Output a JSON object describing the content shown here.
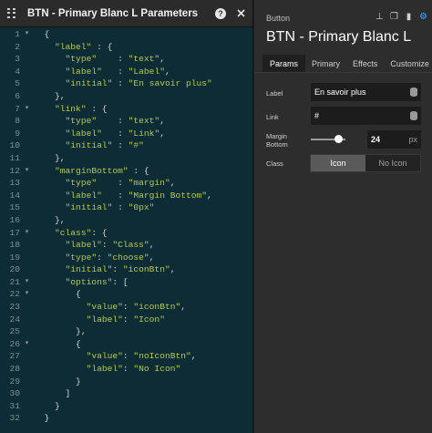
{
  "editor": {
    "title": "BTN - Primary Blanc L Parameters",
    "lines": [
      {
        "n": "1",
        "fold": "▾",
        "parts": [
          [
            "t",
            "  {"
          ]
        ]
      },
      {
        "n": "2",
        "fold": "",
        "parts": [
          [
            "t",
            "    "
          ],
          [
            "s",
            "\"label\""
          ],
          [
            "t",
            " : {"
          ]
        ]
      },
      {
        "n": "3",
        "fold": "",
        "parts": [
          [
            "t",
            "      "
          ],
          [
            "s",
            "\"type\""
          ],
          [
            "t",
            "    : "
          ],
          [
            "s",
            "\"text\""
          ],
          [
            "t",
            ","
          ]
        ]
      },
      {
        "n": "4",
        "fold": "",
        "parts": [
          [
            "t",
            "      "
          ],
          [
            "s",
            "\"label\""
          ],
          [
            "t",
            "   : "
          ],
          [
            "s",
            "\"Label\""
          ],
          [
            "t",
            ","
          ]
        ]
      },
      {
        "n": "5",
        "fold": "",
        "parts": [
          [
            "t",
            "      "
          ],
          [
            "s",
            "\"initial\""
          ],
          [
            "t",
            " : "
          ],
          [
            "s",
            "\"En savoir plus\""
          ]
        ]
      },
      {
        "n": "6",
        "fold": "",
        "parts": [
          [
            "t",
            "    },"
          ]
        ]
      },
      {
        "n": "7",
        "fold": "▾",
        "parts": [
          [
            "t",
            "    "
          ],
          [
            "s",
            "\"link\""
          ],
          [
            "t",
            " : {"
          ]
        ]
      },
      {
        "n": "8",
        "fold": "",
        "parts": [
          [
            "t",
            "      "
          ],
          [
            "s",
            "\"type\""
          ],
          [
            "t",
            "    : "
          ],
          [
            "s",
            "\"text\""
          ],
          [
            "t",
            ","
          ]
        ]
      },
      {
        "n": "9",
        "fold": "",
        "parts": [
          [
            "t",
            "      "
          ],
          [
            "s",
            "\"label\""
          ],
          [
            "t",
            "   : "
          ],
          [
            "s",
            "\"Link\""
          ],
          [
            "t",
            ","
          ]
        ]
      },
      {
        "n": "10",
        "fold": "",
        "parts": [
          [
            "t",
            "      "
          ],
          [
            "s",
            "\"initial\""
          ],
          [
            "t",
            " : "
          ],
          [
            "s",
            "\"#\""
          ]
        ]
      },
      {
        "n": "11",
        "fold": "",
        "parts": [
          [
            "t",
            "    },"
          ]
        ]
      },
      {
        "n": "12",
        "fold": "▾",
        "parts": [
          [
            "t",
            "    "
          ],
          [
            "s",
            "\"marginBottom\""
          ],
          [
            "t",
            " : {"
          ]
        ]
      },
      {
        "n": "13",
        "fold": "",
        "parts": [
          [
            "t",
            "      "
          ],
          [
            "s",
            "\"type\""
          ],
          [
            "t",
            "    : "
          ],
          [
            "s",
            "\"margin\""
          ],
          [
            "t",
            ","
          ]
        ]
      },
      {
        "n": "14",
        "fold": "",
        "parts": [
          [
            "t",
            "      "
          ],
          [
            "s",
            "\"label\""
          ],
          [
            "t",
            "   : "
          ],
          [
            "s",
            "\"Margin Bottom\""
          ],
          [
            "t",
            ","
          ]
        ]
      },
      {
        "n": "15",
        "fold": "",
        "parts": [
          [
            "t",
            "      "
          ],
          [
            "s",
            "\"initial\""
          ],
          [
            "t",
            " : "
          ],
          [
            "s",
            "\"0px\""
          ]
        ]
      },
      {
        "n": "16",
        "fold": "",
        "parts": [
          [
            "t",
            "    },"
          ]
        ]
      },
      {
        "n": "17",
        "fold": "▾",
        "parts": [
          [
            "t",
            "    "
          ],
          [
            "s",
            "\"class\""
          ],
          [
            "t",
            ": {"
          ]
        ]
      },
      {
        "n": "18",
        "fold": "",
        "parts": [
          [
            "t",
            "      "
          ],
          [
            "s",
            "\"label\""
          ],
          [
            "t",
            ": "
          ],
          [
            "s",
            "\"Class\""
          ],
          [
            "t",
            ","
          ]
        ]
      },
      {
        "n": "19",
        "fold": "",
        "parts": [
          [
            "t",
            "      "
          ],
          [
            "s",
            "\"type\""
          ],
          [
            "t",
            ": "
          ],
          [
            "s",
            "\"choose\""
          ],
          [
            "t",
            ","
          ]
        ]
      },
      {
        "n": "20",
        "fold": "",
        "parts": [
          [
            "t",
            "      "
          ],
          [
            "s",
            "\"initial\""
          ],
          [
            "t",
            ": "
          ],
          [
            "s",
            "\"iconBtn\""
          ],
          [
            "t",
            ","
          ]
        ]
      },
      {
        "n": "21",
        "fold": "▾",
        "parts": [
          [
            "t",
            "      "
          ],
          [
            "s",
            "\"options\""
          ],
          [
            "t",
            ": ["
          ]
        ]
      },
      {
        "n": "22",
        "fold": "▾",
        "parts": [
          [
            "t",
            "        {"
          ]
        ]
      },
      {
        "n": "23",
        "fold": "",
        "parts": [
          [
            "t",
            "          "
          ],
          [
            "s",
            "\"value\""
          ],
          [
            "t",
            ": "
          ],
          [
            "s",
            "\"iconBtn\""
          ],
          [
            "t",
            ","
          ]
        ]
      },
      {
        "n": "24",
        "fold": "",
        "parts": [
          [
            "t",
            "          "
          ],
          [
            "s",
            "\"label\""
          ],
          [
            "t",
            ": "
          ],
          [
            "s",
            "\"Icon\""
          ]
        ]
      },
      {
        "n": "25",
        "fold": "",
        "parts": [
          [
            "t",
            "        },"
          ]
        ]
      },
      {
        "n": "26",
        "fold": "▾",
        "parts": [
          [
            "t",
            "        {"
          ]
        ]
      },
      {
        "n": "27",
        "fold": "",
        "parts": [
          [
            "t",
            "          "
          ],
          [
            "s",
            "\"value\""
          ],
          [
            "t",
            ": "
          ],
          [
            "s",
            "\"noIconBtn\""
          ],
          [
            "t",
            ","
          ]
        ]
      },
      {
        "n": "28",
        "fold": "",
        "parts": [
          [
            "t",
            "          "
          ],
          [
            "s",
            "\"label\""
          ],
          [
            "t",
            ": "
          ],
          [
            "s",
            "\"No Icon\""
          ]
        ]
      },
      {
        "n": "29",
        "fold": "",
        "parts": [
          [
            "t",
            "        }"
          ]
        ]
      },
      {
        "n": "30",
        "fold": "",
        "parts": [
          [
            "t",
            "      ]"
          ]
        ]
      },
      {
        "n": "31",
        "fold": "",
        "parts": [
          [
            "t",
            "    }"
          ]
        ]
      },
      {
        "n": "32",
        "fold": "",
        "parts": [
          [
            "t",
            "  }"
          ]
        ]
      }
    ]
  },
  "panel": {
    "type_label": "Button",
    "title": "BTN - Primary Blanc L",
    "tabs": [
      "Params",
      "Primary",
      "Effects",
      "Customize"
    ],
    "active_tab": "Params",
    "label_row": {
      "label": "Label",
      "value": "En savoir plus"
    },
    "link_row": {
      "label": "Link",
      "value": "#"
    },
    "margin_row": {
      "label_line1": "Margin",
      "label_line2": "Bottom",
      "value": "24",
      "unit": "px",
      "slider_level": 0.8
    },
    "class_row": {
      "label": "Class",
      "options": [
        "Icon",
        "No Icon"
      ],
      "selected": "Icon"
    },
    "accent_color": "#3ea6ff"
  }
}
